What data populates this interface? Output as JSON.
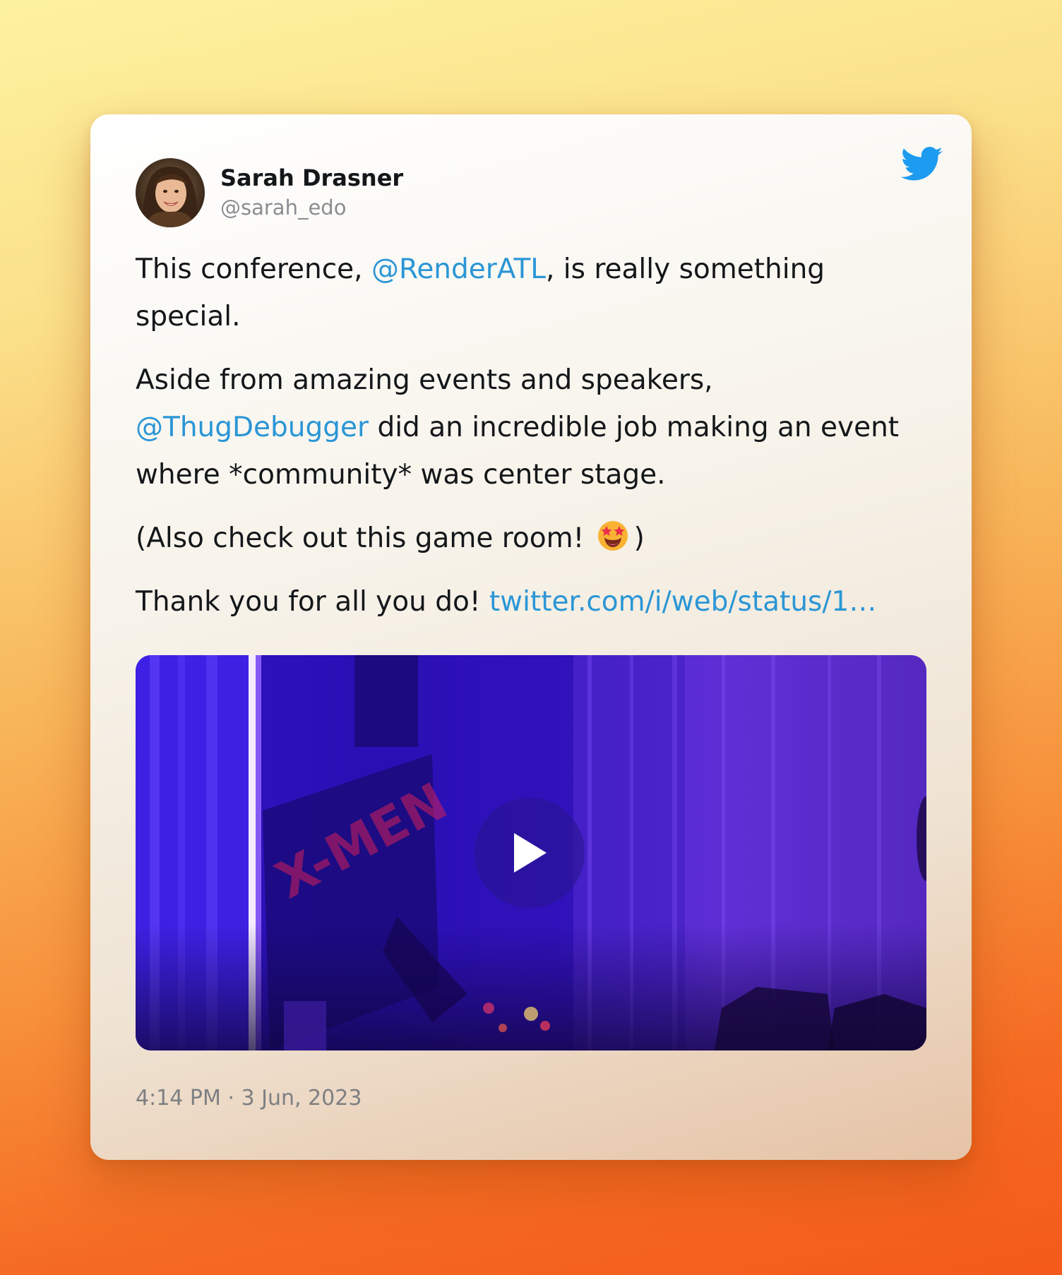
{
  "author": {
    "display_name": "Sarah Drasner",
    "handle": "@sarah_edo",
    "avatar_icon": "avatar-photo"
  },
  "brand": {
    "icon": "twitter-bird-icon",
    "color": "#1d9bf0"
  },
  "tweet": {
    "p1": {
      "before": "This conference, ",
      "mention": "@RenderATL",
      "after": ", is really something special."
    },
    "p2": {
      "before": "Aside from amazing events and speakers, ",
      "mention": "@ThugDebugger",
      "after": " did an incredible job making an event where *community* was center stage."
    },
    "p3": {
      "before": "(Also check out this game room! ",
      "emoji": "star-struck-emoji",
      "after": ")"
    },
    "p4": {
      "before": "Thank you for all you do! ",
      "link": "twitter.com/i/web/status/1…"
    }
  },
  "media": {
    "type": "video",
    "play_icon": "play-icon"
  },
  "timestamp": "4:14 PM · 3 Jun, 2023",
  "colors": {
    "link": "#2b96d6",
    "text": "#14171a",
    "muted": "#7d7f82"
  }
}
